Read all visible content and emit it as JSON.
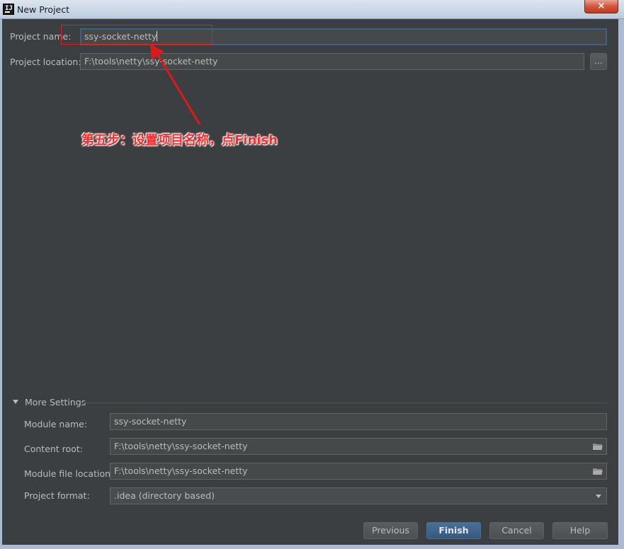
{
  "window": {
    "title": "New Project",
    "close_glyph": "×",
    "app_icon_text": "IJ"
  },
  "form": {
    "project_name_label": "Project name:",
    "project_name_value": "ssy-socket-netty",
    "project_location_label": "Project location:",
    "project_location_value": "F:\\tools\\netty\\ssy-socket-netty",
    "browse_label": "..."
  },
  "more_settings": {
    "title": "More Settings",
    "module_name_label": "Module name:",
    "module_name_value": "ssy-socket-netty",
    "content_root_label": "Content root:",
    "content_root_value": "F:\\tools\\netty\\ssy-socket-netty",
    "module_file_location_label": "Module file location:",
    "module_file_location_value": "F:\\tools\\netty\\ssy-socket-netty",
    "project_format_label": "Project format:",
    "project_format_value": ".idea (directory based)"
  },
  "buttons": {
    "previous": "Previous",
    "finish": "Finish",
    "cancel": "Cancel",
    "help": "Help"
  },
  "annotation": {
    "text": "第五步：设置项目名称，点Finish",
    "color": "#ff2a2a"
  },
  "colors": {
    "background": "#3c3f41",
    "field_bg": "#45494a",
    "focus_border": "#3d6185",
    "primary_button": "#365880"
  }
}
